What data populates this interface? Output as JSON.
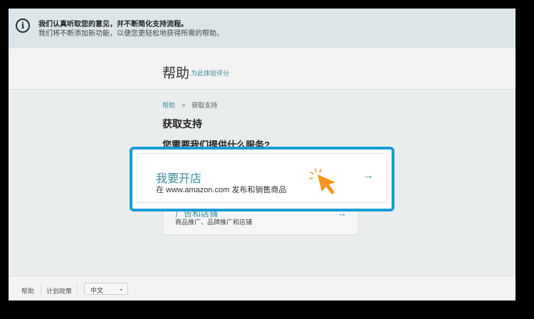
{
  "banner": {
    "title": "我们认真听取您的意见，并不断简化支持流程。",
    "subtitle": "我们将不断添加新功能，以便您更轻松地获得所需的帮助。"
  },
  "header": {
    "title": "帮助",
    "rate_link": "为此体验评分"
  },
  "breadcrumb": {
    "home": "帮助",
    "separator": ">",
    "current": "获取支持"
  },
  "page": {
    "heading": "获取支持",
    "question": "您需要我们提供什么服务?"
  },
  "options": [
    {
      "title": "我要开店",
      "subtitle": "在 www.amazon.com 发布和销售商品",
      "arrow": "→"
    },
    {
      "title": "广告和店铺",
      "subtitle": "商品推广、品牌推广和店铺",
      "arrow": "→"
    }
  ],
  "footer": {
    "help": "帮助",
    "policies": "计划政策",
    "language": "中文",
    "chevron": "⌄"
  },
  "colors": {
    "accent": "#3a8c9c",
    "highlight": "#1a9bd7",
    "cursor": "#f7941d"
  }
}
